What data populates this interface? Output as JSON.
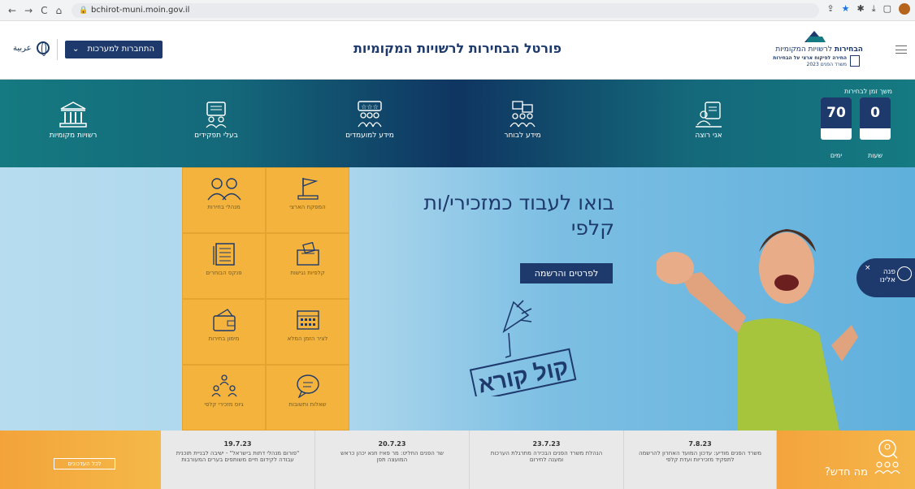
{
  "browser": {
    "back": "←",
    "forward": "→",
    "reload": "C",
    "home": "⌂",
    "url": "bchirot-muni.moin.gov.il",
    "icons": [
      "share",
      "star",
      "puzzle",
      "download",
      "sidebar"
    ]
  },
  "header": {
    "lang": "عربية",
    "login_button": "התחברות למערכות",
    "title": "פורטל הבחירות לרשויות המקומיות",
    "logo_line1_bold": "הבחירות",
    "logo_line1": " לרשויות המקומיות",
    "logo_line2": "החירה לפיקוח ארצי על הבחירות",
    "logo_line3": "משרד הפנים 2023"
  },
  "nav": {
    "items": [
      {
        "label": "רשויות מקומיות",
        "icon": "building-icon"
      },
      {
        "label": "בעלי תפקידים",
        "icon": "roles-icon"
      },
      {
        "label": "מידע למועמדים",
        "icon": "candidates-icon"
      },
      {
        "label": "מידע לבוחר",
        "icon": "voter-icon"
      },
      {
        "label": "אני רוצה",
        "icon": "user-screen-icon"
      }
    ],
    "countdown": {
      "title": "משך זמן לבחירות",
      "hours": "0",
      "hours_label": "שעות",
      "days": "70",
      "days_label": "ימים"
    }
  },
  "tiles": [
    {
      "label": "המפקח הארצי",
      "icon": "flag-icon"
    },
    {
      "label": "מנהלי בחירות",
      "icon": "managers-icon"
    },
    {
      "label": "קלפיות נגישות",
      "icon": "ballot-box-icon"
    },
    {
      "label": "פנקס הבוחרים",
      "icon": "register-book-icon"
    },
    {
      "label": "לציר הזמן המלא",
      "icon": "calendar-icon"
    },
    {
      "label": "מימון בחירות",
      "icon": "wallet-icon"
    },
    {
      "label": "שאלות ותשובות",
      "icon": "chat-icon"
    },
    {
      "label": "גיוס מזכירי קלפי",
      "icon": "recruit-icon"
    }
  ],
  "hero": {
    "headline_1": "בואו לעבוד כמזכירי/ות",
    "headline_2": "קלפי",
    "cta": "לפרטים והרשמה",
    "kol_kore": "קול קורא"
  },
  "chat": {
    "line1": "פנה",
    "line2": "אלינו",
    "close": "×"
  },
  "news": {
    "updates_button": "לכל העדכונים",
    "whats_new": "מה חדש?",
    "items": [
      {
        "date": "7.8.23",
        "text": "משרד הפנים מודיע: עדכון המועד האחרון להרשמה לתפקיד מזכיריות ועדת קלפי"
      },
      {
        "date": "23.7.23",
        "text": "הנהלת משרד הפנים הבכירה מתרגלת הערכות ומענה לחירום"
      },
      {
        "date": "20.7.23",
        "text": "שר הפנים החליט: מר פאיז חנא יכהן כראש המועצה תפן"
      },
      {
        "date": "19.7.23",
        "text": "\"פורום מנהלי דתות בישראל\" - ישיבה לבניית תוכנית עבודה לקידום חיים משותפים בערים המעורבות"
      }
    ]
  },
  "colors": {
    "navy": "#1e3a6d",
    "teal": "#157a81",
    "orange": "#f3b33c",
    "sky": "#a9d5ec"
  }
}
